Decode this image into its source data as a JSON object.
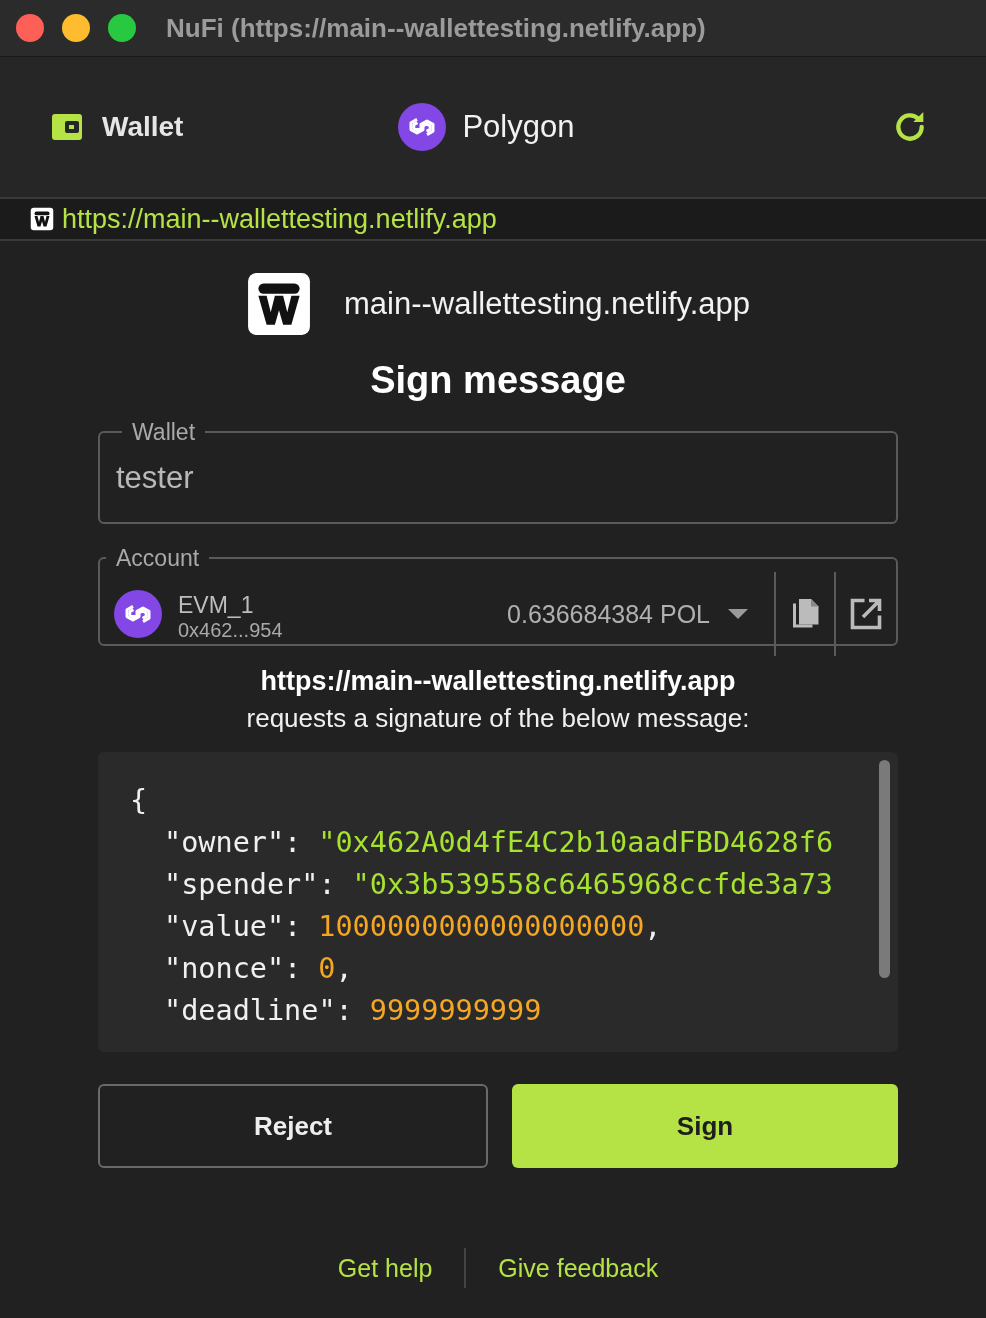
{
  "window": {
    "title": "NuFi (https://main--wallettesting.netlify.app)"
  },
  "header": {
    "wallet_label": "Wallet",
    "network": "Polygon"
  },
  "origin_bar": {
    "url": "https://main--wallettesting.netlify.app"
  },
  "site": {
    "domain": "main--wallettesting.netlify.app"
  },
  "heading": "Sign message",
  "wallet_field": {
    "label": "Wallet",
    "value": "tester"
  },
  "account_field": {
    "label": "Account",
    "name": "EVM_1",
    "address": "0x462...954",
    "balance": "0.636684384 POL"
  },
  "request": {
    "origin": "https://main--wallettesting.netlify.app",
    "text": "requests a signature of the below message:"
  },
  "message": [
    {
      "kind": "brace",
      "text": "{"
    },
    {
      "kind": "string",
      "key": "\"owner\":",
      "value": "\"0x462A0d4fE4C2b10aadFBD4628f6"
    },
    {
      "kind": "string",
      "key": "\"spender\":",
      "value": "\"0x3b539558c6465968ccfde3a73"
    },
    {
      "kind": "number",
      "key": "\"value\":",
      "value": "1000000000000000000",
      "trail": ","
    },
    {
      "kind": "number",
      "key": "\"nonce\":",
      "value": "0",
      "trail": ","
    },
    {
      "kind": "number",
      "key": "\"deadline\":",
      "value": "9999999999"
    }
  ],
  "buttons": [
    {
      "label": "Reject",
      "kind": "secondary"
    },
    {
      "label": "Sign",
      "kind": "primary"
    }
  ],
  "footer_links": [
    "Get help",
    "Give feedback"
  ]
}
